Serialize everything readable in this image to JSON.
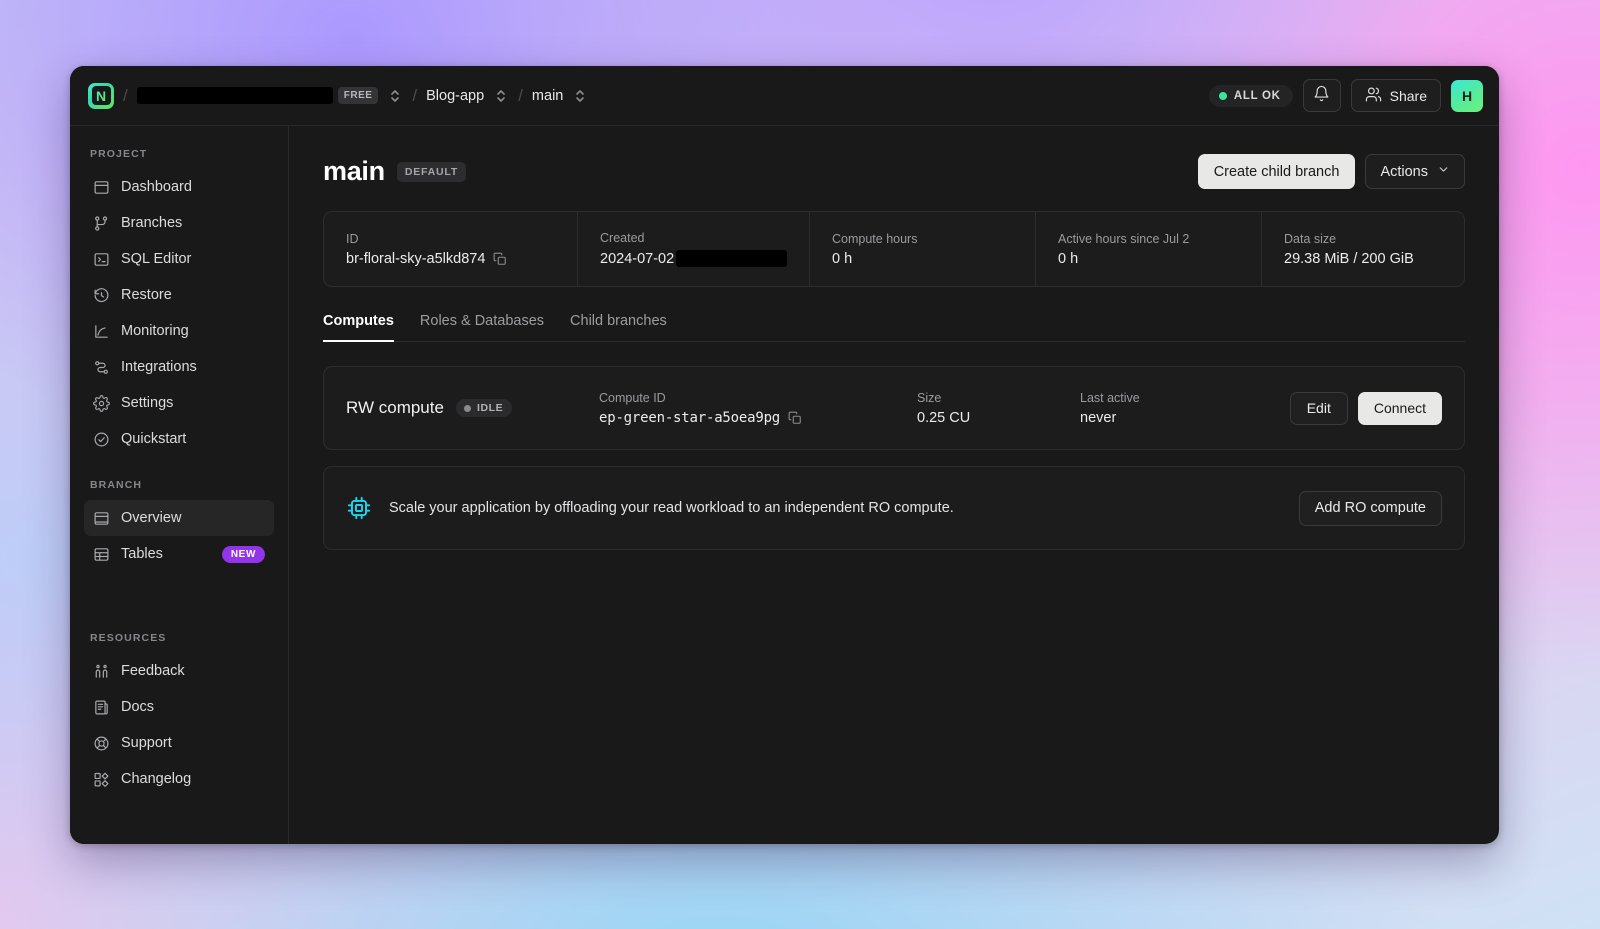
{
  "topbar": {
    "logo_icon": "neon-logo-icon",
    "org_name": "",
    "org_plan_badge": "FREE",
    "project_name": "Blog-app",
    "branch_name": "main",
    "status_badge": "ALL OK",
    "notifications_icon": "bell-icon",
    "share_label": "Share",
    "share_icon": "users-icon",
    "avatar_initial": "H",
    "accent_green": "#37e89a"
  },
  "sidebar": {
    "sections": [
      {
        "heading": "PROJECT",
        "items": [
          {
            "label": "Dashboard",
            "icon": "dashboard-icon",
            "active": false
          },
          {
            "label": "Branches",
            "icon": "branches-icon",
            "active": false
          },
          {
            "label": "SQL Editor",
            "icon": "sql-editor-icon",
            "active": false
          },
          {
            "label": "Restore",
            "icon": "restore-icon",
            "active": false
          },
          {
            "label": "Monitoring",
            "icon": "monitoring-icon",
            "active": false
          },
          {
            "label": "Integrations",
            "icon": "integrations-icon",
            "active": false
          },
          {
            "label": "Settings",
            "icon": "gear-icon",
            "active": false
          },
          {
            "label": "Quickstart",
            "icon": "check-circle-icon",
            "active": false
          }
        ]
      },
      {
        "heading": "BRANCH",
        "items": [
          {
            "label": "Overview",
            "icon": "overview-icon",
            "active": true
          },
          {
            "label": "Tables",
            "icon": "table-icon",
            "active": false,
            "badge": "NEW"
          }
        ]
      },
      {
        "heading": "RESOURCES",
        "items": [
          {
            "label": "Feedback",
            "icon": "feedback-icon",
            "active": false
          },
          {
            "label": "Docs",
            "icon": "docs-icon",
            "active": false
          },
          {
            "label": "Support",
            "icon": "support-icon",
            "active": false
          },
          {
            "label": "Changelog",
            "icon": "changelog-icon",
            "active": false
          }
        ]
      }
    ],
    "badge_color": "#9333ea"
  },
  "page": {
    "title": "main",
    "title_badge": "DEFAULT",
    "create_child_branch_label": "Create child branch",
    "actions_label": "Actions",
    "actions_chevron_icon": "chevron-down-icon"
  },
  "stats": [
    {
      "label": "ID",
      "value": "br-floral-sky-a5lkd874",
      "copy": true
    },
    {
      "label": "Created",
      "value": "2024-07-02",
      "redacted": true
    },
    {
      "label": "Compute hours",
      "value": "0 h"
    },
    {
      "label": "Active hours since Jul 2",
      "value": "0 h"
    },
    {
      "label": "Data size",
      "value": "29.38 MiB / 200 GiB"
    }
  ],
  "tabs": [
    {
      "label": "Computes",
      "active": true
    },
    {
      "label": "Roles & Databases",
      "active": false
    },
    {
      "label": "Child branches",
      "active": false
    }
  ],
  "compute_row": {
    "name": "RW compute",
    "status": "IDLE",
    "compute_id_label": "Compute ID",
    "compute_id_value": "ep-green-star-a5oea9pg",
    "size_label": "Size",
    "size_value": "0.25 CU",
    "last_active_label": "Last active",
    "last_active_value": "never",
    "edit_label": "Edit",
    "connect_label": "Connect",
    "copy_icon": "copy-icon"
  },
  "ro_banner": {
    "icon": "cpu-icon",
    "icon_color": "#22d3ee",
    "text": "Scale your application by offloading your read workload to an independent RO compute.",
    "button_label": "Add RO compute"
  }
}
